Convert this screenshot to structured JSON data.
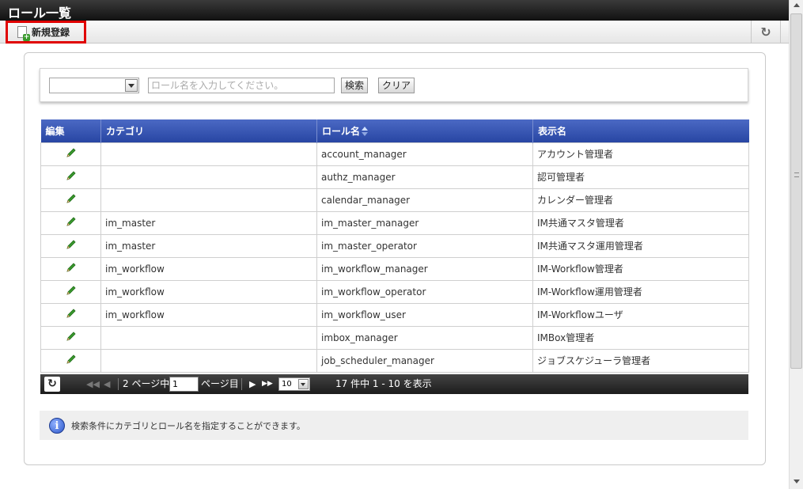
{
  "window": {
    "title": "ロール一覧"
  },
  "toolbar": {
    "new_label": "新規登録",
    "refresh_icon": "refresh-icon"
  },
  "search": {
    "category_value": "",
    "placeholder": "ロール名を入力してください。",
    "search_label": "検索",
    "clear_label": "クリア"
  },
  "table": {
    "headers": {
      "edit": "編集",
      "category": "カテゴリ",
      "role_name": "ロール名",
      "display_name": "表示名"
    },
    "rows": [
      {
        "category": "",
        "role_name": "account_manager",
        "display_name": "アカウント管理者"
      },
      {
        "category": "",
        "role_name": "authz_manager",
        "display_name": "認可管理者"
      },
      {
        "category": "",
        "role_name": "calendar_manager",
        "display_name": "カレンダー管理者"
      },
      {
        "category": "im_master",
        "role_name": "im_master_manager",
        "display_name": "IM共通マスタ管理者"
      },
      {
        "category": "im_master",
        "role_name": "im_master_operator",
        "display_name": "IM共通マスタ運用管理者"
      },
      {
        "category": "im_workflow",
        "role_name": "im_workflow_manager",
        "display_name": "IM-Workflow管理者"
      },
      {
        "category": "im_workflow",
        "role_name": "im_workflow_operator",
        "display_name": "IM-Workflow運用管理者"
      },
      {
        "category": "im_workflow",
        "role_name": "im_workflow_user",
        "display_name": "IM-Workflowユーザ"
      },
      {
        "category": "",
        "role_name": "imbox_manager",
        "display_name": "IMBox管理者"
      },
      {
        "category": "",
        "role_name": "job_scheduler_manager",
        "display_name": "ジョブスケジューラ管理者"
      }
    ]
  },
  "pager": {
    "total_pages_label": "2 ページ中",
    "page_value": "1",
    "page_suffix": "ページ目",
    "page_size": "10",
    "summary": "17 件中 1 - 10 を表示"
  },
  "info": {
    "message": "検索条件にカテゴリとロール名を指定することができます。"
  },
  "colors": {
    "header_blue": "#2f4fb0",
    "highlight_red": "#e00000",
    "edit_green": "#3a9a2e"
  }
}
